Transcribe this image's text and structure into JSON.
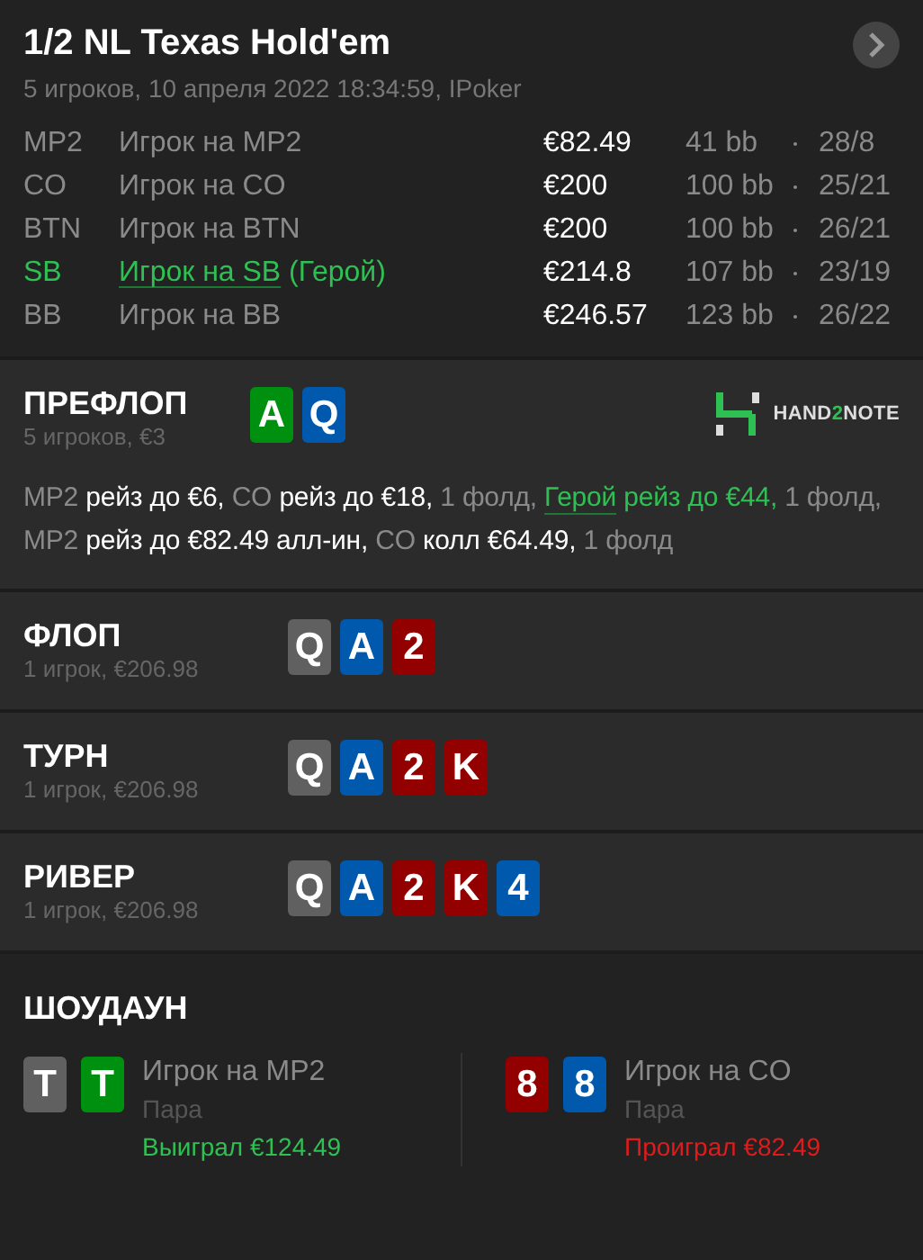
{
  "header": {
    "title": "1/2 NL Texas Hold'em",
    "subtitle": "5 игроков, 10 апреля 2022 18:34:59, IPoker"
  },
  "players": [
    {
      "position": "MP2",
      "name": "Игрок на MP2",
      "stack": "€82.49",
      "bb": "41 bb",
      "stats": "28/8",
      "hero": false
    },
    {
      "position": "CO",
      "name": "Игрок на CO",
      "stack": "€200",
      "bb": "100 bb",
      "stats": "25/21",
      "hero": false
    },
    {
      "position": "BTN",
      "name": "Игрок на BTN",
      "stack": "€200",
      "bb": "100 bb",
      "stats": "26/21",
      "hero": false
    },
    {
      "position": "SB",
      "name": "Игрок на SB",
      "hero_tag": "(Герой)",
      "stack": "€214.8",
      "bb": "107 bb",
      "stats": "23/19",
      "hero": true
    },
    {
      "position": "BB",
      "name": "Игрок на BB",
      "stack": "€246.57",
      "bb": "123 bb",
      "stats": "26/22",
      "hero": false
    }
  ],
  "streets": [
    {
      "title": "ПРЕФЛОП",
      "subtitle": "5 игроков, €3",
      "cards": [
        {
          "rank": "A",
          "color": "#00900f"
        },
        {
          "rank": "Q",
          "color": "#0059ad"
        }
      ],
      "logo": [
        {
          "text": "HAND",
          "accent": false
        },
        {
          "text": "2",
          "accent": true
        },
        {
          "text": "NOTE",
          "accent": false
        }
      ],
      "actions": [
        {
          "kind": "actor",
          "text": "MP2 "
        },
        {
          "kind": "action",
          "text": "рейз до €6,"
        },
        {
          "kind": "actor",
          "text": " CO "
        },
        {
          "kind": "action",
          "text": "рейз до €18,"
        },
        {
          "kind": "actor",
          "text": " 1 фолд, "
        },
        {
          "kind": "hero_link",
          "text": "Герой"
        },
        {
          "kind": "hero_action",
          "text": " рейз до €44,"
        },
        {
          "kind": "actor",
          "text": " 1 фолд, MP2 "
        },
        {
          "kind": "action",
          "text": "рейз до €82.49 алл-ин,"
        },
        {
          "kind": "actor",
          "text": " CO "
        },
        {
          "kind": "action",
          "text": "колл €64.49,"
        },
        {
          "kind": "actor",
          "text": " 1 фолд"
        }
      ]
    },
    {
      "title": "ФЛОП",
      "subtitle": "1 игрок, €206.98",
      "cards": [
        {
          "rank": "Q",
          "color": "#606060"
        },
        {
          "rank": "A",
          "color": "#0059ad"
        },
        {
          "rank": "2",
          "color": "#930000"
        }
      ]
    },
    {
      "title": "ТУРН",
      "subtitle": "1 игрок, €206.98",
      "cards": [
        {
          "rank": "Q",
          "color": "#606060"
        },
        {
          "rank": "A",
          "color": "#0059ad"
        },
        {
          "rank": "2",
          "color": "#930000"
        },
        {
          "rank": "K",
          "color": "#930000"
        }
      ]
    },
    {
      "title": "РИВЕР",
      "subtitle": "1 игрок, €206.98",
      "cards": [
        {
          "rank": "Q",
          "color": "#606060"
        },
        {
          "rank": "A",
          "color": "#0059ad"
        },
        {
          "rank": "2",
          "color": "#930000"
        },
        {
          "rank": "K",
          "color": "#930000"
        },
        {
          "rank": "4",
          "color": "#0059ad"
        }
      ]
    }
  ],
  "showdown": {
    "title": "ШОУДАУН",
    "hands": [
      {
        "cards": [
          {
            "rank": "T",
            "color": "#606060"
          },
          {
            "rank": "T",
            "color": "#00900f"
          }
        ],
        "player": "Игрок на MP2",
        "combo": "Пара",
        "result": "Выиграл €124.49",
        "won": true
      },
      {
        "cards": [
          {
            "rank": "8",
            "color": "#930000"
          },
          {
            "rank": "8",
            "color": "#0059ad"
          }
        ],
        "player": "Игрок на CO",
        "combo": "Пара",
        "result": "Проиграл €82.49",
        "won": false
      }
    ]
  }
}
